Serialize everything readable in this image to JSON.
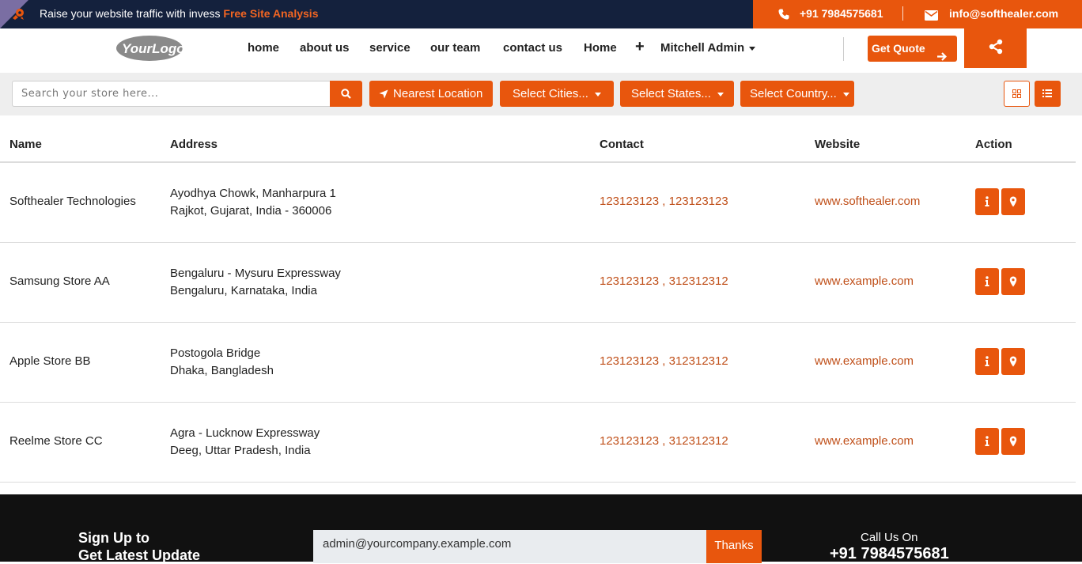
{
  "topbar": {
    "promo_text": "Raise your website traffic with invess ",
    "promo_highlight": "Free Site Analysis",
    "phone": "+91  7984575681",
    "email": "info@softhealer.com",
    "icons": [
      "rocket-icon",
      "phone-icon",
      "envelope-icon"
    ]
  },
  "nav": {
    "logo_text": "YourLogo",
    "items": [
      {
        "label": "home"
      },
      {
        "label": "about us"
      },
      {
        "label": "service"
      },
      {
        "label": "our team"
      },
      {
        "label": "contact us"
      },
      {
        "label": "Home"
      }
    ],
    "plus_label": "+",
    "user": "Mitchell Admin",
    "quote_label": "Get Quote"
  },
  "filters": {
    "search_placeholder": "Search your store here...",
    "nearest_label": "Nearest Location",
    "cities_label": "Select Cities...",
    "states_label": "Select States...",
    "country_label": "Select Country..."
  },
  "table": {
    "headers": {
      "name": "Name",
      "address": "Address",
      "contact": "Contact",
      "website": "Website",
      "action": "Action"
    },
    "rows": [
      {
        "name": "Softhealer Technologies",
        "address1": "Ayodhya Chowk, Manharpura 1",
        "address2": "Rajkot, Gujarat, India - 360006",
        "phone1": "123123123",
        "phone2": "123123123",
        "website": "www.softhealer.com"
      },
      {
        "name": "Samsung Store AA",
        "address1": "Bengaluru - Mysuru Expressway",
        "address2": "Bengaluru, Karnataka, India",
        "phone1": "123123123",
        "phone2": "312312312",
        "website": "www.example.com"
      },
      {
        "name": "Apple Store BB",
        "address1": "Postogola Bridge",
        "address2": "Dhaka, Bangladesh",
        "phone1": "123123123",
        "phone2": "312312312",
        "website": "www.example.com"
      },
      {
        "name": "Reelme Store CC",
        "address1": "Agra - Lucknow Expressway",
        "address2": "Deeg, Uttar Pradesh, India",
        "phone1": "123123123",
        "phone2": "312312312",
        "website": "www.example.com"
      }
    ]
  },
  "footer": {
    "signup_line1": "Sign Up to",
    "signup_line2": "Get Latest Update",
    "newsletter_value": "admin@yourcompany.example.com",
    "thanks_label": "Thanks",
    "call_label": "Call Us On",
    "call_number": "+91 7984575681"
  },
  "colors": {
    "accent": "#e8560d",
    "topbar": "#14213d",
    "link": "#c0501a",
    "footer": "#111111",
    "filterbar": "#eeeeee"
  }
}
